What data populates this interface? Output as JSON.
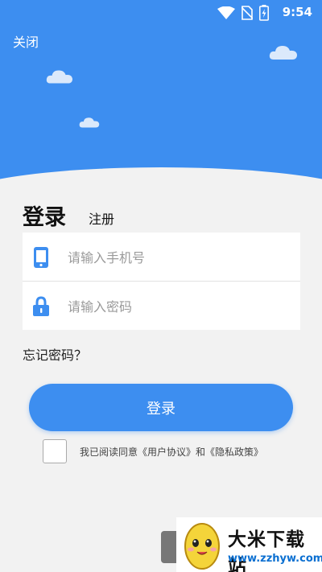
{
  "status": {
    "time": "9:54"
  },
  "header": {
    "close_label": "关闭"
  },
  "tabs": {
    "login": "登录",
    "register": "注册"
  },
  "form": {
    "phone_placeholder": "请输入手机号",
    "password_placeholder": "请输入密码"
  },
  "forgot_password": "忘记密码？",
  "login_button": "登录",
  "agreement": {
    "text": "我已阅读同意《用户协议》和《隐私政策》",
    "checked": false
  },
  "watermark": {
    "name": "大米下载站",
    "url": "www.zzhyw.com"
  },
  "colors": {
    "primary": "#3d8ef0",
    "background": "#f2f2f2",
    "card": "#ffffff"
  }
}
